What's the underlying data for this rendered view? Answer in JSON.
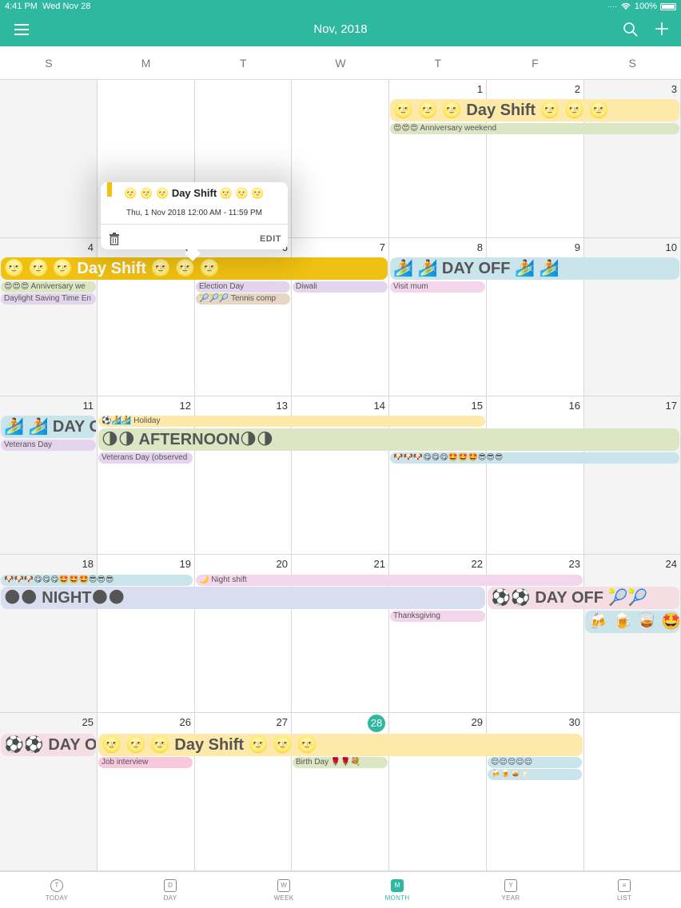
{
  "status": {
    "time": "4:41 PM",
    "date": "Wed Nov 28",
    "battery": "100%"
  },
  "nav": {
    "title": "Nov, 2018"
  },
  "weekdays": [
    "S",
    "M",
    "T",
    "W",
    "T",
    "F",
    "S"
  ],
  "days": {
    "w1": [
      "",
      "",
      "",
      "",
      "1",
      "2",
      "3"
    ],
    "w2": [
      "4",
      "5",
      "6",
      "7",
      "8",
      "9",
      "10"
    ],
    "w3": [
      "11",
      "12",
      "13",
      "14",
      "15",
      "16",
      "17"
    ],
    "w4": [
      "18",
      "19",
      "20",
      "21",
      "22",
      "23",
      "24"
    ],
    "w5": [
      "25",
      "26",
      "27",
      "28",
      "29",
      "30",
      ""
    ]
  },
  "events": {
    "day_shift_1": "🌝 🌝 🌝 Day  Shift 🌝 🌝 🌝",
    "anniversary_1": "😍😍😍 Anniversary weekend",
    "day_shift_2": "🌝 🌝 🌝 Day  Shift 🌝 🌝 🌝",
    "anniversary_2": "😍😍😍 Anniversary we",
    "daylight": "Daylight Saving Time En",
    "election": "Election Day",
    "tennis": "🎾🎾🎾 Tennis comp",
    "diwali": "Diwali",
    "day_off_1": "🏄 🏄 DAY OFF 🏄 🏄",
    "visit_mum": "Visit mum",
    "day_off_2": "🏄 🏄 DAY O",
    "veterans": "Veterans Day",
    "holiday": "⚽🏄🏄 Holiday",
    "afternoon": "🌗🌗 AFTERNOON🌗🌗",
    "veterans_obs": "Veterans Day (observed",
    "emoji_row_1": "🐶🐶🐶😋😋😋🤩🤩🤩😎😎😎",
    "emoji_row_2": "🐶🐶🐶😋😋😋🤩🤩🤩😎😎😎",
    "night_shift": "🌙 Night shift",
    "night": "🌑🌑 NIGHT🌑🌑",
    "day_off_3": "⚽⚽ DAY OFF 🎾🎾",
    "thanksgiving": "Thanksgiving",
    "drinks_big": "🍻 🍺 🥃 🤩",
    "day_off_4": "⚽⚽ DAY O",
    "day_shift_3": "🌝 🌝 🌝 Day  Shift 🌝 🌝 🌝",
    "job_interview": "Job interview",
    "birthday": "Birth Day 🌹🌹💐",
    "sleepy": "😌😌😌😌😌",
    "drinks_small": "🍻🍺🥃🥛"
  },
  "popup": {
    "title": "🌝 🌝 🌝  Day  Shift 🌝 🌝 🌝",
    "time": "Thu, 1 Nov 2018 12:00 AM - 11:59 PM",
    "edit": "EDIT"
  },
  "today": "28",
  "tabs": [
    "TODAY",
    "DAY",
    "WEEK",
    "MONTH",
    "YEAR",
    "LIST"
  ],
  "tab_glyphs": [
    "T",
    "D",
    "W",
    "M",
    "Y",
    "≡"
  ],
  "accent": "#2fb8a0"
}
